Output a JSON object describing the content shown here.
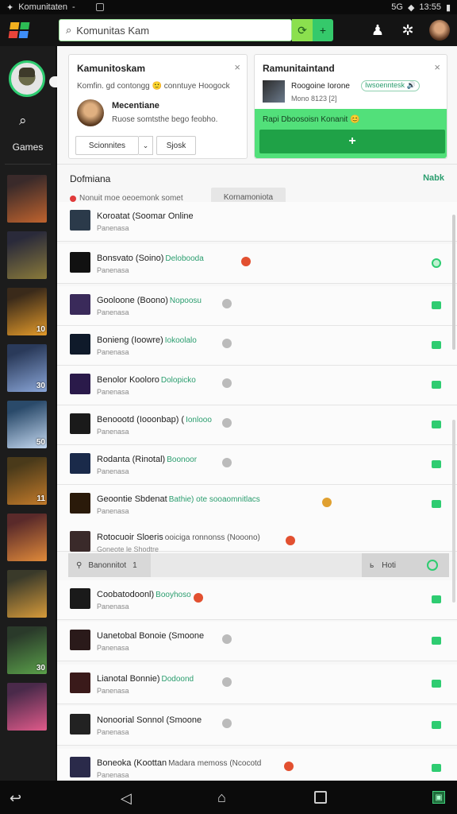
{
  "status_bar": {
    "app_label": "Komunitaten",
    "indicator": "-",
    "time": "13:55",
    "signal": "5G"
  },
  "top_bar": {
    "search_value": "Komunitas Kam",
    "search_placeholder": "Komunitas Kam"
  },
  "left_rail": {
    "label": "Games",
    "games": [
      {
        "name": "game-1",
        "count": "",
        "colors": [
          "#3a2a2a",
          "#c0632e"
        ]
      },
      {
        "name": "game-2",
        "count": "",
        "colors": [
          "#2a2a3a",
          "#8a7a3a"
        ]
      },
      {
        "name": "game-3",
        "count": "10",
        "colors": [
          "#3a2a1a",
          "#e39a2a"
        ]
      },
      {
        "name": "game-4",
        "count": "30",
        "colors": [
          "#2a3a5a",
          "#8aa6d8"
        ]
      },
      {
        "name": "game-5",
        "count": "50",
        "colors": [
          "#2a4a6a",
          "#c4d8f0"
        ]
      },
      {
        "name": "game-6",
        "count": "11",
        "colors": [
          "#4a3a1a",
          "#c27a2a"
        ]
      },
      {
        "name": "game-7",
        "count": "",
        "colors": [
          "#5a2a2a",
          "#e08a3a"
        ]
      },
      {
        "name": "game-8",
        "count": "",
        "colors": [
          "#3a3a2a",
          "#d69a3a"
        ]
      },
      {
        "name": "game-9",
        "count": "30",
        "colors": [
          "#2a3a2a",
          "#5aa04a"
        ]
      },
      {
        "name": "game-10",
        "count": "",
        "colors": [
          "#4a2a4a",
          "#e05a8a"
        ]
      }
    ]
  },
  "card_left": {
    "title": "Kamunitoskam",
    "desc": "Komfin. gd contongg 🙂 conntuye Hoogock",
    "person_name": "Mecentiane",
    "person_sub": "Ruose somtsthe bego  feobho.",
    "btn_main": "Scionnites",
    "btn_caret": "⌄",
    "btn_second": "Sjosk"
  },
  "card_right": {
    "title": "Ramunitaintand",
    "line1": "Roogoine Iorone",
    "tag": "Iwsoenntesk 🔊",
    "line2": "Mono 8123 [2]",
    "green_text": "Rapi Dboosoisn Konanit 😊",
    "green_btn": "+"
  },
  "section": {
    "title": "Dofmiana",
    "link": "Nabk",
    "info": "Nonuit moe oeoemonk somet",
    "button": "Kornamoniota"
  },
  "friends": [
    {
      "name": "Koroatat (Soomar Online",
      "status": "",
      "sub": "Panenasa",
      "icon": "",
      "chat": ""
    },
    {
      "name": "Bonsvato (Soino)",
      "status": "Delobooda",
      "sub": "Panenasa",
      "icon": "#e25030",
      "chat": "square"
    },
    {
      "name": "Gooloone (Boono)",
      "status": "Nopoosu",
      "sub": "Panenasa",
      "icon": "#bbbbbb",
      "chat": "square"
    },
    {
      "name": "Bonieng (Ioowre)",
      "status": "Iokoolalo",
      "sub": "Panenasa",
      "icon": "#bbbbbb",
      "chat": "square"
    },
    {
      "name": "Benolor Kooloro",
      "status": "Dolopicko",
      "sub": "Panenasa",
      "icon": "#bbbbbb",
      "chat": "square"
    },
    {
      "name": "Benoootd (Iooonbap) (",
      "status": "Ionlooo",
      "sub": "Panenasa",
      "icon": "#bbbbbb",
      "chat": "square"
    },
    {
      "name": "Rodanta (Rinotal)",
      "status": "Boonoor",
      "sub": "Panenasa",
      "icon": "#bbbbbb",
      "chat": "square"
    },
    {
      "name": "Geoontie Sbdenat",
      "status": "Bathie) ote sooaomnitlacs",
      "sub": "Panenasa",
      "icon": "#e0a030",
      "chat": "square"
    },
    {
      "name": "Rotocuoir Sloeris",
      "status": "ooiciga ronnonss  (Nooono)",
      "sub": "Goneote le Shodtre",
      "icon": "#e25030",
      "chat": ""
    },
    {
      "name": "Coobatodoonl)",
      "status": "Booyhoso",
      "sub": "Panenasa",
      "icon": "#e25030",
      "chat": "square"
    },
    {
      "name": "Uanetobal Bonoie (Smoone",
      "status": "",
      "sub": "Panenasa",
      "icon": "#bbbbbb",
      "chat": "square"
    },
    {
      "name": "Lianotal Bonnie)",
      "status": "Dodoond",
      "sub": "Panenasa",
      "icon": "#bbbbbb",
      "chat": "square"
    },
    {
      "name": "Nonoorial Sonnol (Smoone",
      "status": "",
      "sub": "Panenasa",
      "icon": "#bbbbbb",
      "chat": "square"
    },
    {
      "name": "Boneoka (Koottan",
      "status": "Madara memoss (Ncocotd",
      "sub": "Panenasa",
      "icon": "#e25030",
      "chat": "square"
    }
  ],
  "action_bar": {
    "left_label": "Banonnitot",
    "left_count": "1",
    "right_label": "Hoti"
  },
  "colors": {
    "accent": "#2ecc71",
    "accent_dark": "#1fa247",
    "status_green": "#2a9d6e"
  }
}
